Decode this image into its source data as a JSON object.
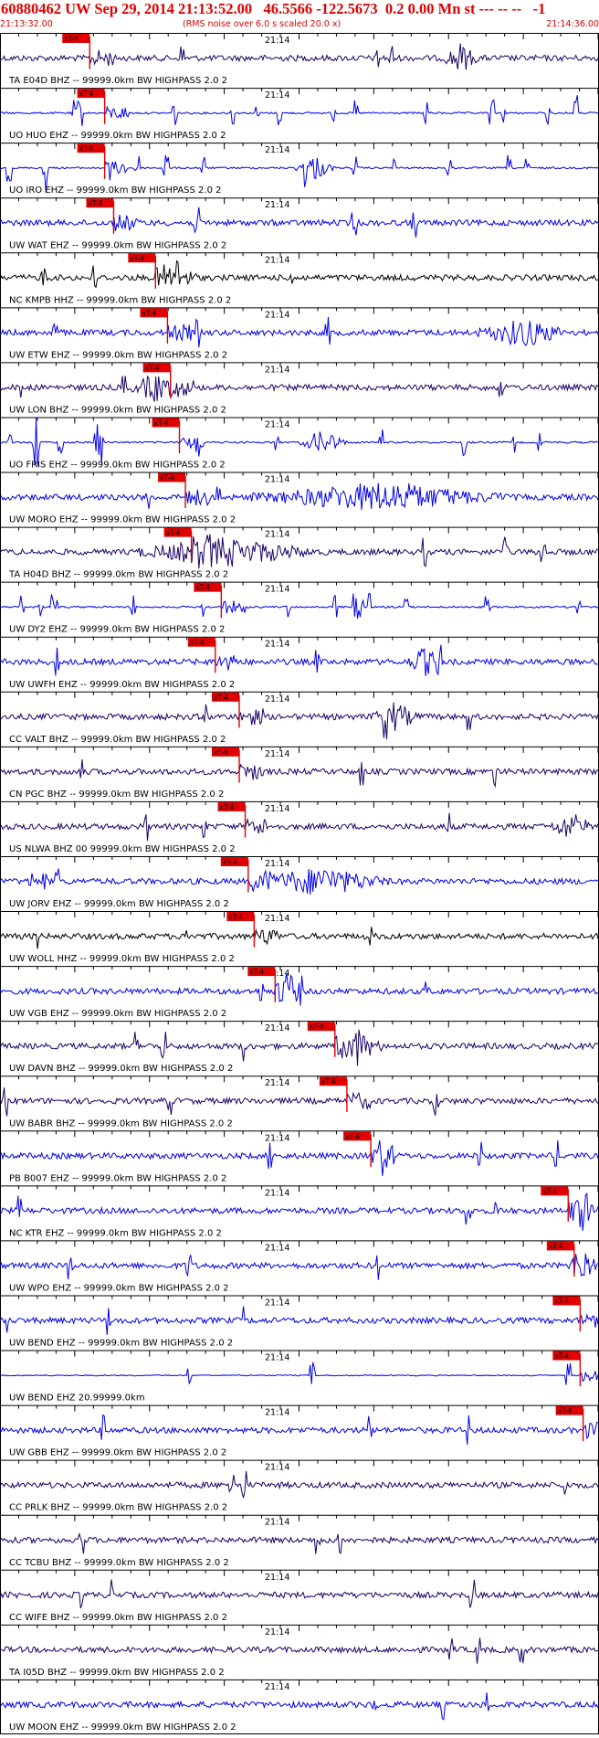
{
  "header": {
    "title": "60880462 UW Sep 29, 2014 21:13:52.00   46.5566 -122.5673  0.2 0.00 Mn st --- -- --   -1",
    "start_time": "21:13:32.00",
    "rms_note": "(RMS noise over 6.0 s scaled 20.0 x)",
    "end_time": "21:14:36.00"
  },
  "colors": {
    "pick": "#e00000",
    "blue": "#0000e6",
    "navy": "#1a0066",
    "black": "#000000",
    "frame": "#000000"
  },
  "pick_label": "xT-4",
  "center_time_label": "21:14",
  "traces": [
    {
      "label": "TA E04D BHZ -- 99999.0km BW  HIGHPASS  2.0  2",
      "color": "navy",
      "pick": 0.15,
      "style": "noise_burst",
      "burst": [
        0.74,
        0.8
      ]
    },
    {
      "label": "UO HUO EHZ -- 99999.0km BW  HIGHPASS  2.0  2",
      "color": "blue",
      "pick": 0.175,
      "style": "spiky"
    },
    {
      "label": "UO IRO EHZ -- 99999.0km BW  HIGHPASS  2.0  2",
      "color": "blue",
      "pick": 0.175,
      "style": "spiky_burst",
      "burst": [
        0.49,
        0.56
      ]
    },
    {
      "label": "UW WAT EHZ -- 99999.0km BW  HIGHPASS  2.0  2",
      "color": "blue",
      "pick": 0.19,
      "style": "noise"
    },
    {
      "label": "NC KMPB HHZ -- 99999.0km BW  HIGHPASS  2.0  2",
      "color": "black",
      "pick": 0.26,
      "style": "noise_burst",
      "burst": [
        0.26,
        0.33
      ]
    },
    {
      "label": "UW ETW EHZ -- 99999.0km BW  HIGHPASS  2.0  2",
      "color": "blue",
      "pick": 0.28,
      "style": "noise_burst",
      "burst": [
        0.8,
        0.95
      ]
    },
    {
      "label": "UW LON BHZ -- 99999.0km BW  HIGHPASS  2.0  2",
      "color": "navy",
      "pick": 0.285,
      "style": "noise_burst",
      "burst": [
        0.22,
        0.3
      ]
    },
    {
      "label": "UO FRIS EHZ -- 99999.0km BW  HIGHPASS  2.0  2",
      "color": "blue",
      "pick": 0.3,
      "style": "spiky_burst",
      "burst": [
        0.5,
        0.58
      ]
    },
    {
      "label": "UW MORO EHZ -- 99999.0km BW  HIGHPASS  2.0  2",
      "color": "blue",
      "pick": 0.31,
      "style": "noise_burst",
      "burst": [
        0.42,
        0.85
      ]
    },
    {
      "label": "TA H04D BHZ -- 99999.0km BW  HIGHPASS  2.0  2",
      "color": "navy",
      "pick": 0.32,
      "style": "noise_burst",
      "burst": [
        0.22,
        0.53
      ]
    },
    {
      "label": "UW DY2 EHZ -- 99999.0km BW  HIGHPASS  2.0  2",
      "color": "blue",
      "pick": 0.37,
      "style": "spiky"
    },
    {
      "label": "UW UWFH EHZ -- 99999.0km BW  HIGHPASS  2.0  2",
      "color": "blue",
      "pick": 0.36,
      "style": "noise_burst",
      "burst": [
        0.68,
        0.74
      ]
    },
    {
      "label": "CC VALT BHZ -- 99999.0km BW  HIGHPASS  2.0  2",
      "color": "navy",
      "pick": 0.4,
      "style": "noise_burst",
      "burst": [
        0.62,
        0.7
      ]
    },
    {
      "label": "CN PGC BHZ -- 99999.0km BW  HIGHPASS  2.0  2",
      "color": "navy",
      "pick": 0.4,
      "style": "noise"
    },
    {
      "label": "US NLWA BHZ 00 99999.0km BW  HIGHPASS  2.0  2",
      "color": "navy",
      "pick": 0.41,
      "style": "noise_burst",
      "burst": [
        0.92,
        0.99
      ]
    },
    {
      "label": "UW JORV EHZ -- 99999.0km BW  HIGHPASS  2.0  2",
      "color": "blue",
      "pick": 0.415,
      "style": "noise_burst",
      "burst": [
        0.42,
        0.65
      ]
    },
    {
      "label": "UW WOLL HHZ -- 99999.0km BW  HIGHPASS  2.0  2",
      "color": "black",
      "pick": 0.425,
      "style": "noise"
    },
    {
      "label": "UW VGB EHZ -- 99999.0km BW  HIGHPASS  2.0  2",
      "color": "blue",
      "pick": 0.46,
      "style": "noise_burst",
      "burst": [
        0.46,
        0.5
      ]
    },
    {
      "label": "UW DAVN BHZ -- 99999.0km BW  HIGHPASS  2.0  2",
      "color": "navy",
      "pick": 0.56,
      "style": "noise_burst",
      "burst": [
        0.56,
        0.64
      ]
    },
    {
      "label": "UW BABR BHZ -- 99999.0km BW  HIGHPASS  2.0  2",
      "color": "navy",
      "pick": 0.58,
      "style": "noise"
    },
    {
      "label": "PB B007 EHZ -- 99999.0km BW  HIGHPASS  2.0  2",
      "color": "blue",
      "pick": 0.62,
      "style": "noise_burst",
      "burst": [
        0.62,
        0.66
      ]
    },
    {
      "label": "NC KTR EHZ -- 99999.0km BW  HIGHPASS  2.0  2",
      "color": "blue",
      "pick": 0.95,
      "style": "noise_burst",
      "burst": [
        0.95,
        1.0
      ]
    },
    {
      "label": "UW WPO EHZ -- 99999.0km BW  HIGHPASS  2.0  2",
      "color": "blue",
      "pick": 0.96,
      "style": "noise_burst",
      "burst": [
        0.95,
        0.99
      ]
    },
    {
      "label": "UW BEND EHZ -- 99999.0km BW  HIGHPASS  2.0  2",
      "color": "blue",
      "pick": 0.97,
      "style": "noise"
    },
    {
      "label": "UW BEND EHZ 20.99999.0km",
      "color": "blue",
      "pick": 0.97,
      "style": "flat"
    },
    {
      "label": "UW GBB EHZ -- 99999.0km BW  HIGHPASS  2.0  2",
      "color": "blue",
      "pick": 0.975,
      "style": "noise"
    },
    {
      "label": "CC PRLK BHZ -- 99999.0km BW  HIGHPASS  2.0  2",
      "color": "navy",
      "pick": null,
      "style": "noise"
    },
    {
      "label": "CC TCBU BHZ -- 99999.0km BW  HIGHPASS  2.0  2",
      "color": "navy",
      "pick": null,
      "style": "noise"
    },
    {
      "label": "CC WIFE BHZ -- 99999.0km BW  HIGHPASS  2.0  2",
      "color": "navy",
      "pick": null,
      "style": "noise"
    },
    {
      "label": "TA I05D BHZ -- 99999.0km BW  HIGHPASS  2.0  2",
      "color": "navy",
      "pick": null,
      "style": "noise"
    },
    {
      "label": "UW MOON EHZ -- 99999.0km BW  HIGHPASS  2.0  2",
      "color": "blue",
      "pick": null,
      "style": "noise"
    }
  ]
}
